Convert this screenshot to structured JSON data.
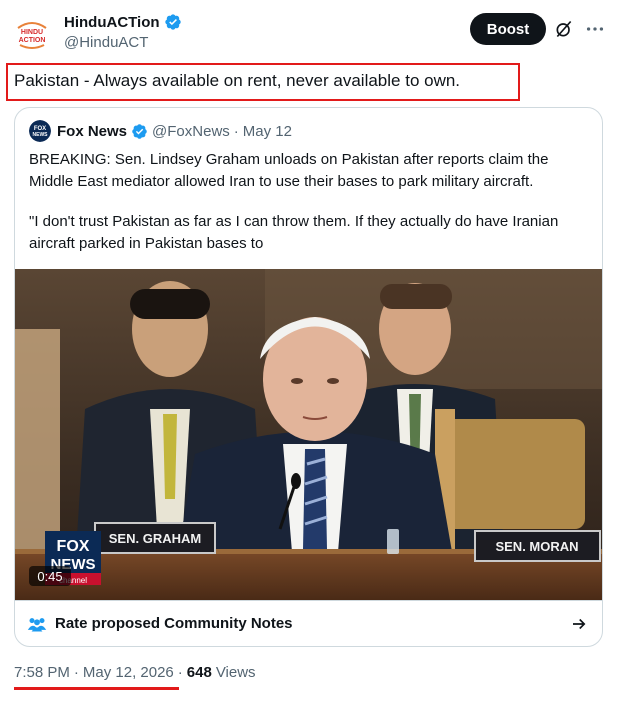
{
  "author": {
    "name": "HinduACTion",
    "handle": "@HinduACT",
    "avatar_text": "HINDU ACTION"
  },
  "header": {
    "boost_label": "Boost",
    "icons": [
      "verified-badge-icon",
      "grok-slash-icon",
      "more-options-icon"
    ]
  },
  "tweet": {
    "text": "Pakistan - Always available on rent, never available to own."
  },
  "quote": {
    "name": "Fox News",
    "handle": "@FoxNews",
    "separator": "·",
    "date": "May 12",
    "avatar_text": "FOX NEWS",
    "paragraph1": "BREAKING: Sen. Lindsey Graham unloads on Pakistan after reports claim the Middle East mediator allowed Iran to use their bases to park  military aircraft.",
    "paragraph2": "\"I don't trust Pakistan as far as I can throw them. If they actually do have Iranian aircraft parked in Pakistan bases to",
    "media": {
      "nameplate_left": "SEN. GRAHAM",
      "nameplate_right": "SEN. MORAN",
      "channel_logo_line1": "FOX",
      "channel_logo_line2": "NEWS",
      "channel_logo_line3": "channel",
      "duration": "0:45"
    },
    "community_notes_label": "Rate proposed Community Notes"
  },
  "meta": {
    "time": "7:58 PM",
    "separator": "·",
    "date": "May 12, 2026",
    "separator2": "·",
    "views_count": "648",
    "views_label": "Views"
  },
  "colors": {
    "highlight_red": "#e21a1a",
    "verified_blue": "#1d9bf0",
    "text_secondary": "#536471"
  }
}
